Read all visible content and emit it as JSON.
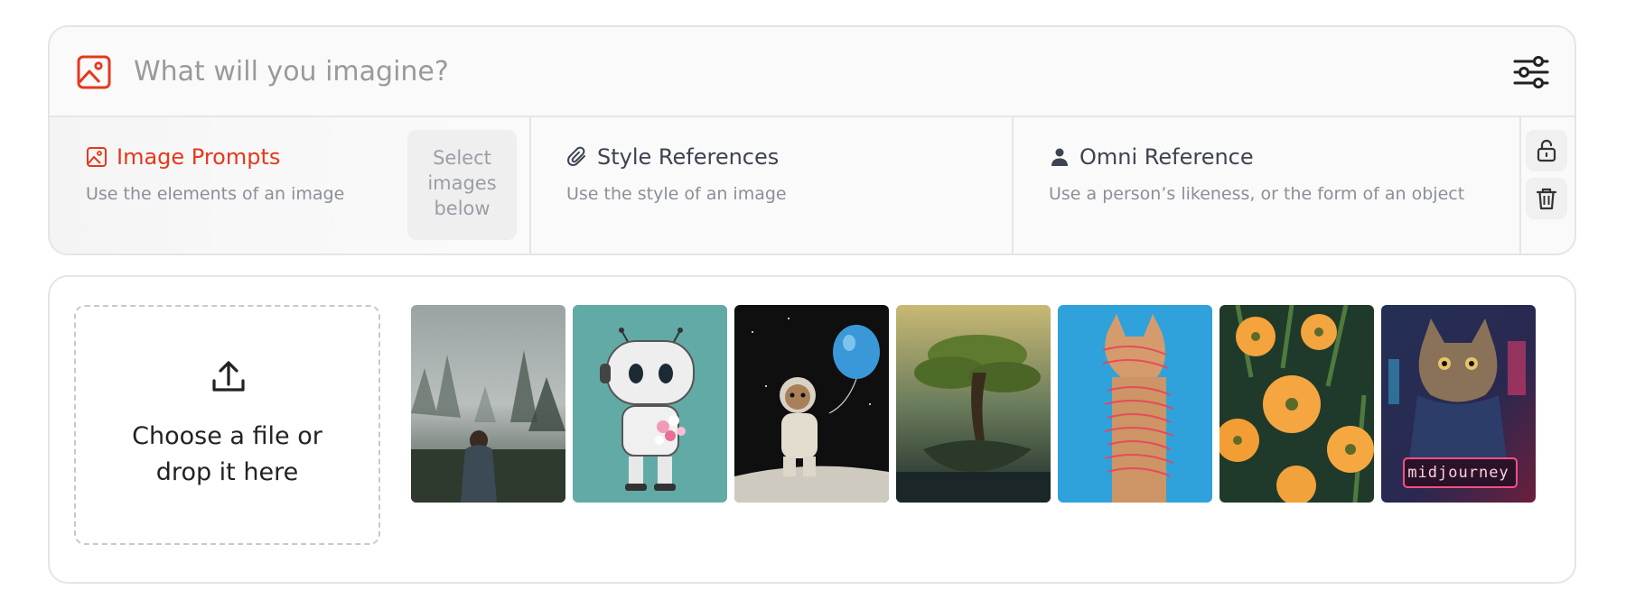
{
  "prompt": {
    "placeholder": "What will you imagine?",
    "value": "",
    "icon": "image-icon",
    "settings_icon": "sliders-icon"
  },
  "tabs": [
    {
      "title": "Image Prompts",
      "subtitle": "Use the elements of an image",
      "icon": "image-icon",
      "active": true
    },
    {
      "title": "Style References",
      "subtitle": "Use the style of an image",
      "icon": "paperclip-icon",
      "active": false
    },
    {
      "title": "Omni Reference",
      "subtitle": "Use a person’s likeness, or the form of an object",
      "icon": "person-icon",
      "active": false
    }
  ],
  "select_hint": "Select images below",
  "side_actions": [
    {
      "icon": "unlock-icon"
    },
    {
      "icon": "trash-icon"
    }
  ],
  "dropzone": {
    "text": "Choose a file or drop it here",
    "icon": "upload-icon"
  },
  "gallery": {
    "thumbnails": [
      {
        "subject": "woman in foggy forest"
      },
      {
        "subject": "robot holding flowers"
      },
      {
        "subject": "astronaut cat with balloon"
      },
      {
        "subject": "tree on floating island"
      },
      {
        "subject": "cat wrapped in red threads"
      },
      {
        "subject": "orange poppies"
      },
      {
        "subject": "neon cyberpunk cat",
        "caption": "midjourney"
      }
    ]
  },
  "colors": {
    "accent": "#e5381c",
    "text": "#3d4350",
    "muted": "#8a8f99",
    "border": "#e5e5e5"
  }
}
